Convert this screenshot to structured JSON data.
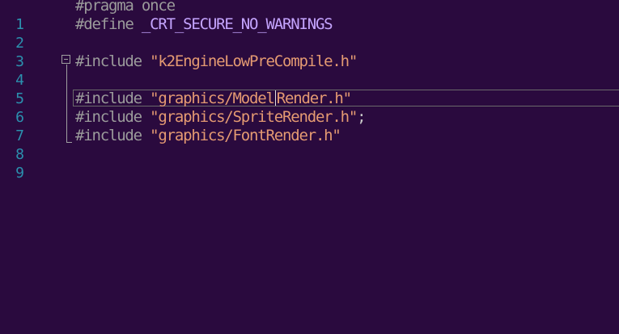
{
  "lines": [
    {
      "num": "1",
      "directive": "#pragma",
      "rest": " once",
      "rest_type": "kw"
    },
    {
      "num": "2",
      "directive": "#define",
      "rest": " _CRT_SECURE_NO_WARNINGS",
      "rest_type": "macro"
    },
    {
      "num": "3"
    },
    {
      "num": "4",
      "directive": "#include",
      "rest": " \"k2EngineLowPreCompile.h\"",
      "rest_type": "str"
    },
    {
      "num": "5"
    },
    {
      "num": "6",
      "directive": "#include",
      "rest_a": " \"graphics/Model",
      "rest_b": "Render.h\"",
      "rest_type": "str"
    },
    {
      "num": "7",
      "directive": "#include",
      "rest": " \"graphics/SpriteRender.h\"",
      "rest_type": "str",
      "trail": ";"
    },
    {
      "num": "8",
      "directive": "#include",
      "rest": " \"graphics/FontRender.h\"",
      "rest_type": "str"
    },
    {
      "num": "9"
    }
  ],
  "colors": {
    "background": "#2a0a3e",
    "line_number": "#2b91af",
    "directive": "#9b9b9b",
    "macro": "#c5a5ff",
    "string": "#e49a72"
  }
}
